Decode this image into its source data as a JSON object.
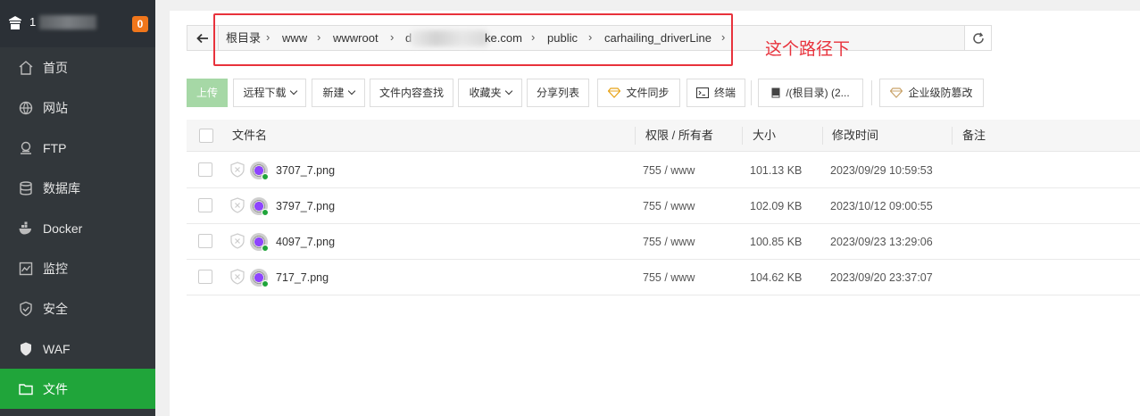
{
  "sidebar": {
    "server_label": "1",
    "badge": "0",
    "items": [
      {
        "label": "首页",
        "icon": "home-icon",
        "active": false
      },
      {
        "label": "网站",
        "icon": "globe-icon",
        "active": false
      },
      {
        "label": "FTP",
        "icon": "ftp-icon",
        "active": false
      },
      {
        "label": "数据库",
        "icon": "database-icon",
        "active": false
      },
      {
        "label": "Docker",
        "icon": "docker-icon",
        "active": false
      },
      {
        "label": "监控",
        "icon": "monitor-icon",
        "active": false
      },
      {
        "label": "安全",
        "icon": "shield-icon",
        "active": false
      },
      {
        "label": "WAF",
        "icon": "waf-shield-icon",
        "active": false
      },
      {
        "label": "文件",
        "icon": "folder-icon",
        "active": true
      }
    ]
  },
  "path": {
    "crumbs": [
      "根目录",
      "www",
      "wwwroot",
      "d",
      "ke.com",
      "public",
      "carhailing_driverLine"
    ],
    "annotation": "这个路径下"
  },
  "toolbar": {
    "upload": "上传",
    "remote_download": "远程下载",
    "new": "新建",
    "content_search": "文件内容查找",
    "favorites": "收藏夹",
    "share_list": "分享列表",
    "file_sync": "文件同步",
    "terminal": "终端",
    "disk": "/(根目录) (2...",
    "tamper": "企业级防篡改"
  },
  "table": {
    "headers": {
      "name": "文件名",
      "perm": "权限 / 所有者",
      "size": "大小",
      "mtime": "修改时间",
      "note": "备注"
    },
    "rows": [
      {
        "name": "3707_7.png",
        "perm": "755 / www",
        "size": "101.13 KB",
        "mtime": "2023/09/29 10:59:53"
      },
      {
        "name": "3797_7.png",
        "perm": "755 / www",
        "size": "102.09 KB",
        "mtime": "2023/10/12 09:00:55"
      },
      {
        "name": "4097_7.png",
        "perm": "755 / www",
        "size": "100.85 KB",
        "mtime": "2023/09/23 13:29:06"
      },
      {
        "name": "717_7.png",
        "perm": "755 / www",
        "size": "104.62 KB",
        "mtime": "2023/09/20 23:37:07"
      }
    ]
  },
  "colors": {
    "accent": "#20a53a",
    "sidebar": "#32373b",
    "annotation": "#e8323c",
    "badge": "#f0761b"
  }
}
